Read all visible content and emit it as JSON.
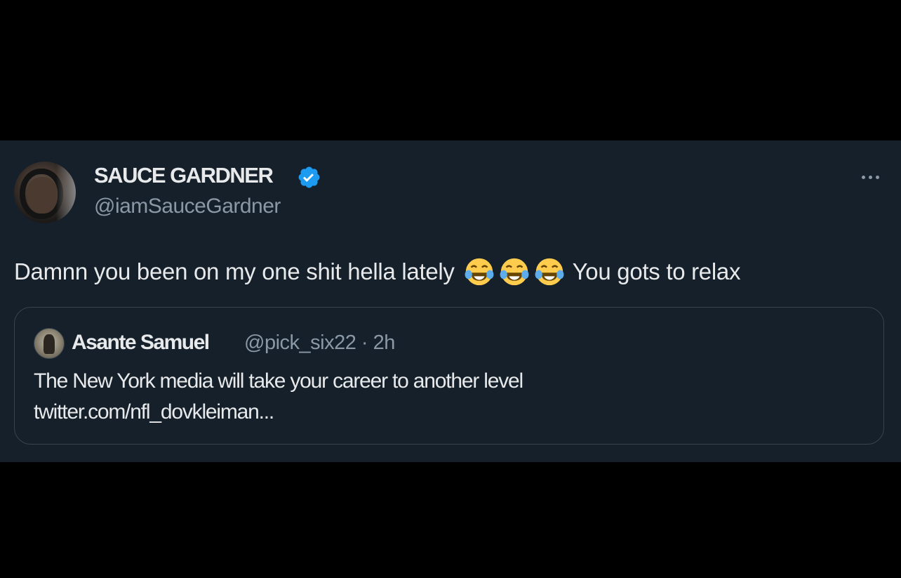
{
  "tweet": {
    "author": {
      "display_name": "SAUCE GARDNER",
      "handle": "@iamSauceGardner",
      "verified_color": "#1d9bf0"
    },
    "text_before_emoji": "Damnn you been on my one shit hella lately",
    "emojis": [
      "face-with-tears-of-joy",
      "face-with-tears-of-joy",
      "face-with-tears-of-joy"
    ],
    "text_after_emoji": "You gots to relax",
    "more_icon": "ellipsis-icon"
  },
  "quote": {
    "author": "Asante Samuel",
    "meta": "@pick_six22 · 2h",
    "line1": "The New York media will take your career to another level",
    "line2": "twitter.com/nfl_dovkleiman..."
  },
  "colors": {
    "background": "#15202b",
    "text": "#e7e9ea",
    "secondary": "#8b98a5",
    "border": "#38444d"
  }
}
